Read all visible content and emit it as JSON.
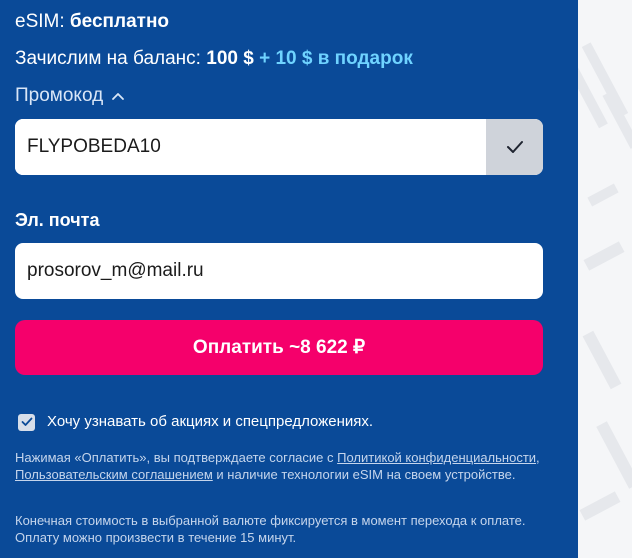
{
  "summary": {
    "esim_label": "eSIM:",
    "esim_value": "бесплатно",
    "credit_label": "Зачислим на баланс:",
    "credit_amount": "100 $",
    "credit_bonus": "+ 10 $ в подарок"
  },
  "promo": {
    "toggle_label": "Промокод",
    "value": "FLYPOBEDA10"
  },
  "email": {
    "label": "Эл. почта",
    "value": "prosorov_m@mail.ru"
  },
  "pay": {
    "label": "Оплатить ~8 622 ₽"
  },
  "consent": {
    "checked": true,
    "label": "Хочу узнавать об акциях и спецпредложениях."
  },
  "legal": {
    "text_1": "Нажимая «Оплатить», вы подтверждаете согласие с ",
    "link_privacy": "Политикой конфиденциальности",
    "sep": ", ",
    "link_terms": "Пользовательским соглашением",
    "text_2": " и наличие технологии eSIM на своем устройстве."
  },
  "note": {
    "text": "Конечная стоимость в выбранной валюте фиксируется в момент перехода к оплате. Оплату можно произвести в течение 15 минут."
  },
  "colors": {
    "panel": "#0a4a98",
    "accent_pink": "#f5006b",
    "bonus_cyan": "#6fd3ff"
  },
  "icons": {
    "promo_toggle": "chevron-up-icon",
    "promo_apply": "check-icon",
    "consent_checkbox": "check-icon"
  }
}
